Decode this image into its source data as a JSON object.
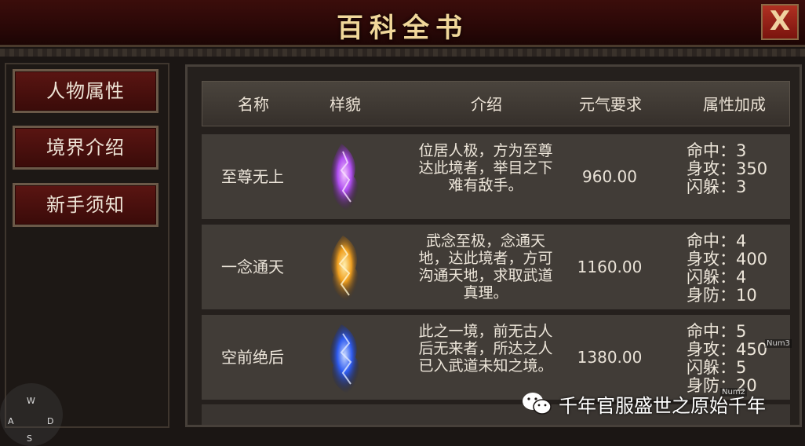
{
  "window": {
    "title": "百科全书",
    "close_label": "X"
  },
  "sidebar": {
    "items": [
      {
        "label": "人物属性"
      },
      {
        "label": "境界介绍"
      },
      {
        "label": "新手须知"
      }
    ]
  },
  "table": {
    "headers": [
      "名称",
      "样貌",
      "介绍",
      "元气要求",
      "属性加成"
    ],
    "rows": [
      {
        "name": "至尊无上",
        "portrait_color": "#b04ff0",
        "desc": "位居人极，方为至尊达此境者，举目之下难有敌手。",
        "requirement": "960.00",
        "attrs": [
          "命中：3",
          "身攻：350",
          "闪躲：3"
        ]
      },
      {
        "name": "一念通天",
        "portrait_color": "#f0a020",
        "desc": "武念至极，念通天地，达此境者，方可沟通天地，求取武道真理。",
        "requirement": "1160.00",
        "attrs": [
          "命中：4",
          "身攻：400",
          "闪躲：4",
          "身防：10"
        ]
      },
      {
        "name": "空前绝后",
        "portrait_color": "#2f5cf0",
        "desc": "此之一境，前无古人后无来者，所达之人已入武道未知之境。",
        "requirement": "1380.00",
        "attrs": [
          "命中：5",
          "身攻：450",
          "闪躲：5",
          "身防：20"
        ]
      }
    ]
  },
  "overlay": {
    "compass": [
      "W",
      "A",
      "D",
      "S"
    ],
    "num_tags": [
      "Num3",
      "Num2"
    ],
    "watermark": "千年官服盛世之原始千年"
  }
}
